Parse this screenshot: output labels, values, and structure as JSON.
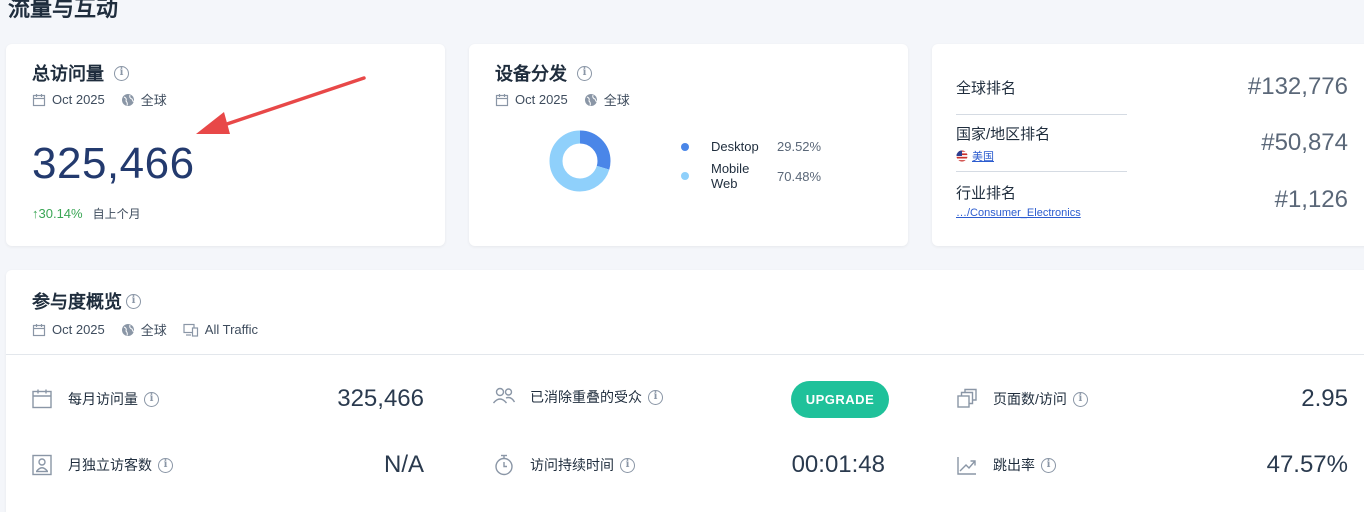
{
  "section": {
    "title": "流量与互动"
  },
  "total_visits": {
    "title": "总访问量",
    "date": "Oct 2025",
    "region": "全球",
    "value": "325,466",
    "change": "30.14%",
    "change_note": "自上个月"
  },
  "device": {
    "title": "设备分发",
    "date": "Oct 2025",
    "region": "全球",
    "items": [
      {
        "label": "Desktop",
        "value": "29.52%",
        "share": 29.52,
        "color": "#4a86e8"
      },
      {
        "label": "Mobile Web",
        "value": "70.48%",
        "share": 70.48,
        "color": "#8fd0fb"
      }
    ]
  },
  "ranks": {
    "global": {
      "label": "全球排名",
      "value": "#132,776"
    },
    "country": {
      "label": "国家/地区排名",
      "sub": "美国",
      "value": "#50,874"
    },
    "industry": {
      "label": "行业排名",
      "sub": "…/Consumer_Electronics",
      "value": "#1,126"
    }
  },
  "engagement": {
    "title": "参与度概览",
    "date": "Oct 2025",
    "region": "全球",
    "traffic": "All Traffic",
    "upgrade_label": "UPGRADE",
    "metrics": {
      "monthly_visits": {
        "label": "每月访问量",
        "value": "325,466"
      },
      "dedup_audience": {
        "label": "已消除重叠的受众"
      },
      "pages_per_visit": {
        "label": "页面数/访问",
        "value": "2.95"
      },
      "unique_visitors": {
        "label": "月独立访客数",
        "value": "N/A"
      },
      "visit_duration": {
        "label": "访问持续时间",
        "value": "00:01:48"
      },
      "bounce_rate": {
        "label": "跳出率",
        "value": "47.57%"
      }
    }
  }
}
